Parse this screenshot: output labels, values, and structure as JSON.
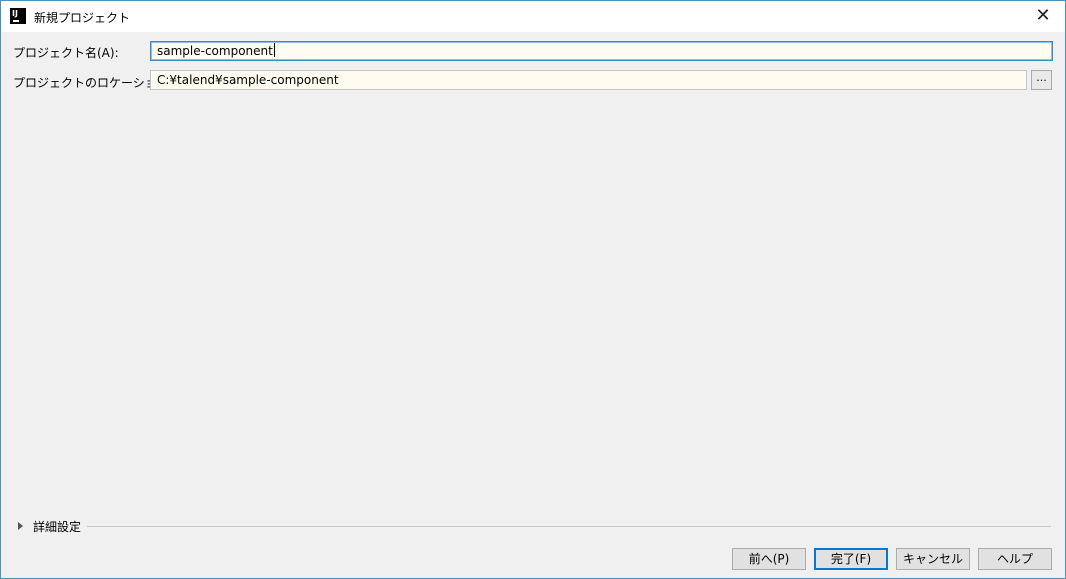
{
  "window": {
    "title": "新規プロジェクト",
    "close_symbol": "✕"
  },
  "form": {
    "project_name_label": "プロジェクト名(A):",
    "project_name_value": "sample-component",
    "project_location_label": "プロジェクトのロケーション(L):",
    "project_location_value": "C:¥talend¥sample-component",
    "browse_label": "..."
  },
  "advanced": {
    "label": "詳細設定",
    "expanded": false
  },
  "buttons": {
    "previous": "前へ(P)",
    "finish": "完了(F)",
    "cancel": "キャンセル",
    "help": "ヘルプ"
  },
  "icons": {
    "app": "intellij-idea-icon",
    "close": "close-icon",
    "expand": "expand-triangle-icon"
  },
  "colors": {
    "field_background": "#fffbf0",
    "focus_border": "#3d8cc5",
    "primary_button_border": "#0078d7",
    "window_border": "#4c8fb8"
  }
}
